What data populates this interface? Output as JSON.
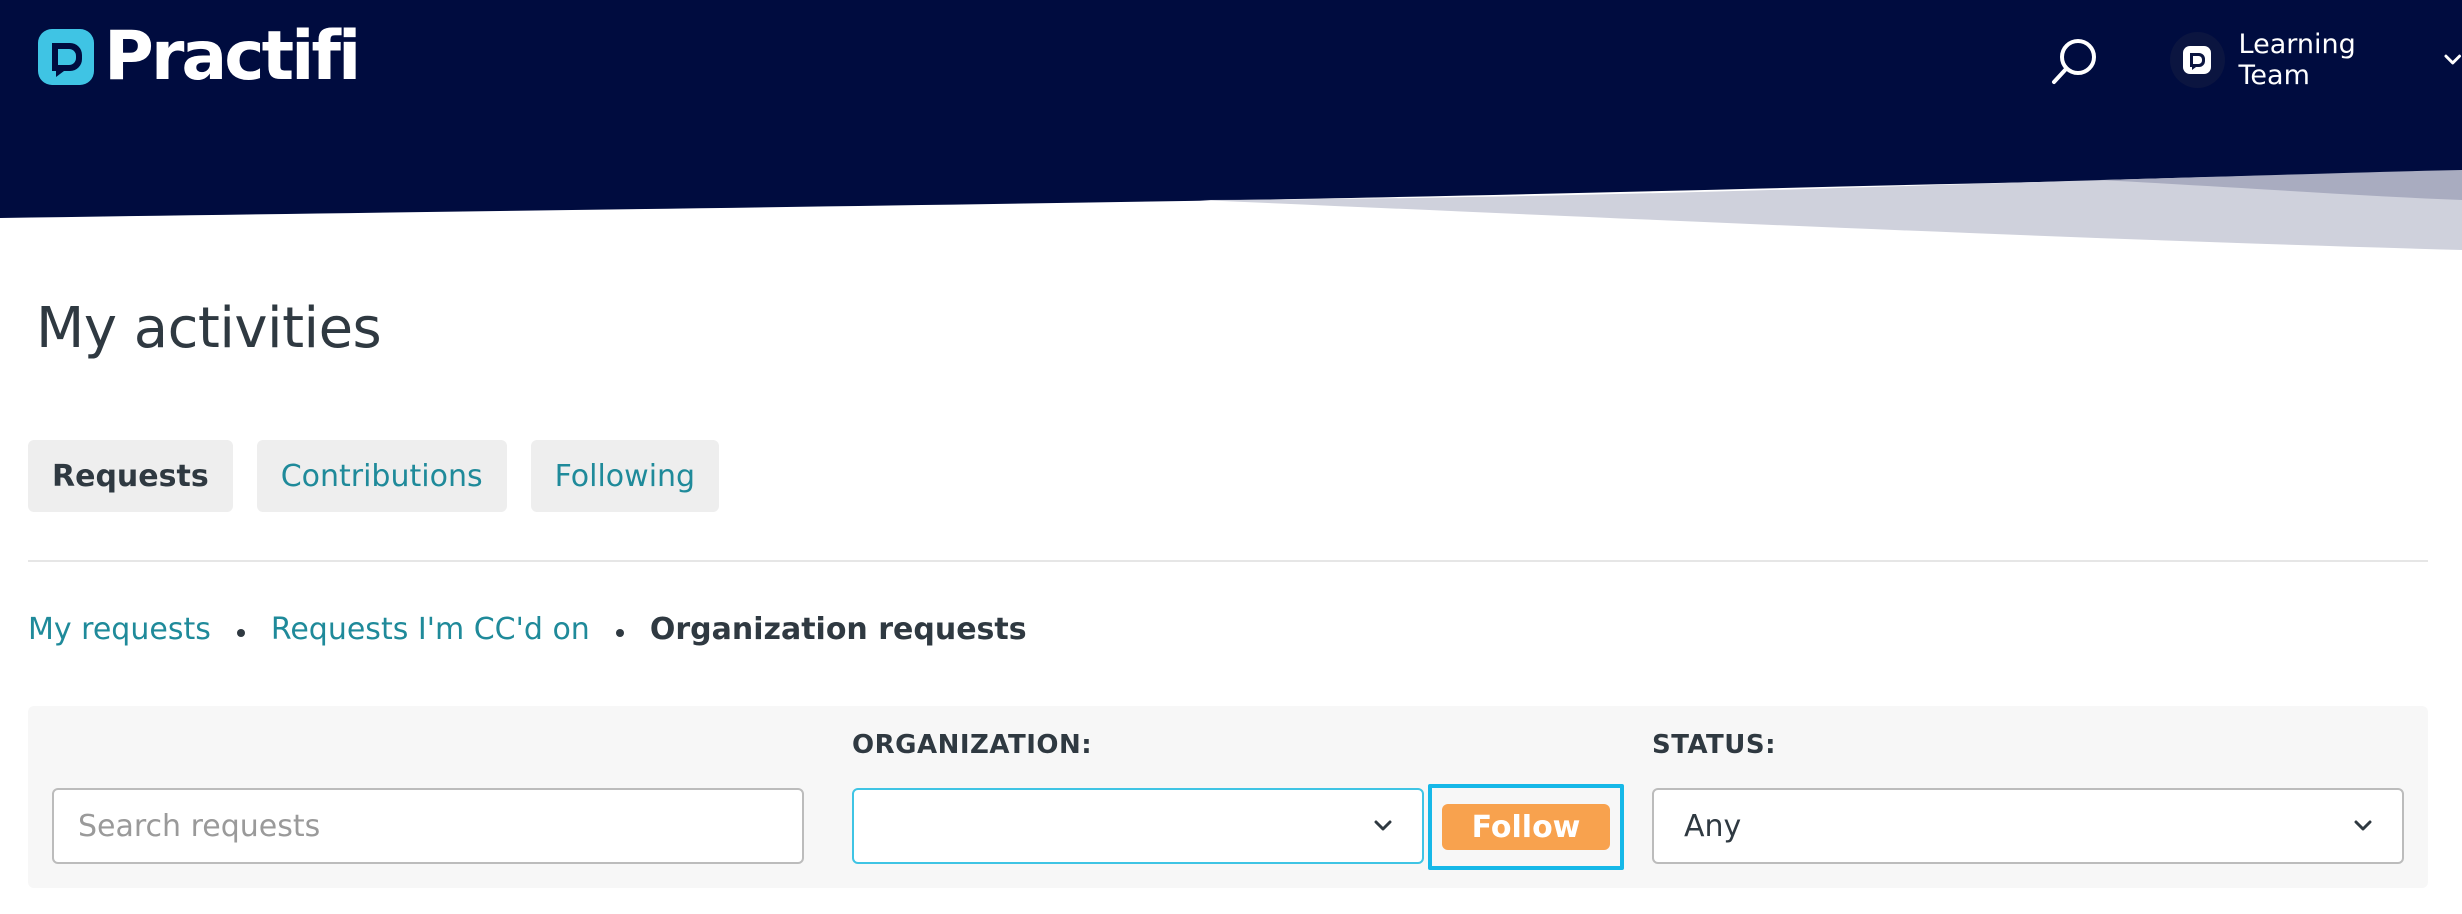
{
  "header": {
    "logo_text": "Practifi",
    "user_name": "Learning Team",
    "colors": {
      "navy": "#000c3f",
      "accent": "#3fc4e4"
    }
  },
  "page": {
    "title": "My activities"
  },
  "tabs": [
    {
      "label": "Requests",
      "active": true
    },
    {
      "label": "Contributions",
      "active": false
    },
    {
      "label": "Following",
      "active": false
    }
  ],
  "subnav": {
    "my_requests": "My requests",
    "cc_requests": "Requests I'm CC'd on",
    "org_requests": "Organization requests"
  },
  "filters": {
    "search_placeholder": "Search requests",
    "organization_label": "ORGANIZATION:",
    "organization_value": "",
    "follow_label": "Follow",
    "status_label": "STATUS:",
    "status_value": "Any"
  },
  "colors": {
    "link": "#1f8a9a",
    "follow_button": "#f8a24e",
    "highlight": "#16b8e8"
  }
}
